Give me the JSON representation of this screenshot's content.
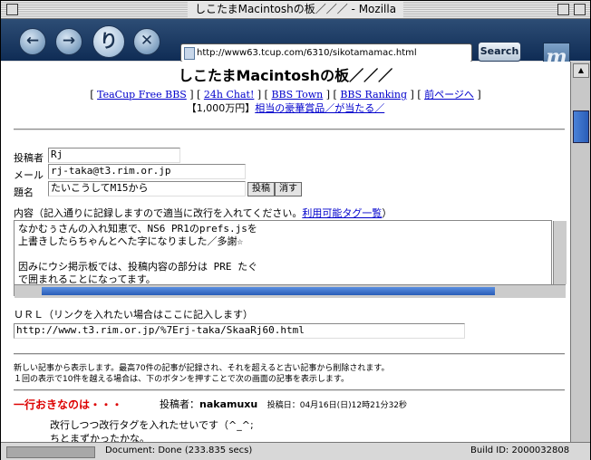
{
  "window": {
    "title": "しこたまMacintoshの板／／／ - Mozilla"
  },
  "toolbar": {
    "url": "http://www63.tcup.com/6310/sikotamamac.html",
    "search_label": "Search",
    "logo": "m",
    "back_icon": "back-arrow",
    "forward_icon": "forward-arrow",
    "reload_glyph": "り",
    "stop_glyph": "✕"
  },
  "page": {
    "heading": "しこたまMacintoshの板／／／",
    "nav_links": [
      "TeaCup Free BBS",
      "24h Chat!",
      "BBS Town",
      "BBS Ranking",
      "前ページへ"
    ],
    "promo_prefix": "【1,000万円】",
    "promo_link": "相当の豪華賞品／が当たる／"
  },
  "form": {
    "poster_label": "投稿者",
    "poster_value": "Rj",
    "email_label": "メール",
    "email_value": "rj-taka@t3.rim.or.jp",
    "subject_label": "題名",
    "subject_value": "たいこうしてM15から",
    "submit_label": "投稿",
    "clear_label": "消す",
    "content_label": "内容（記入通りに記録しますので適当に改行を入れてください。",
    "content_link": "利用可能タグ一覧",
    "content_label_end": "）",
    "content_lines": [
      "なかむぅさんの入れ知恵で、NS6 PR1のprefs.jsを",
      "上書きしたらちゃんとへた字になりました／多謝☆",
      "",
      "因みにウシ掲示板では、投稿内容の部分は PRE たぐ",
      "で囲まれることになってます。"
    ],
    "url_label": "ＵＲＬ（リンクを入れたい場合はここに記入します）",
    "url_value": "http://www.t3.rim.or.jp/%7Erj-taka/SkaaRj60.html"
  },
  "notice": {
    "line1": "新しい記事から表示します。最高70件の記事が記録され、それを超えると古い記事から削除されます。",
    "line2": "１回の表示で10件を越える場合は、下のボタンを押すことで次の画面の記事を表示します。"
  },
  "post": {
    "title": "一行おきなのは・・・",
    "poster_label": "投稿者：",
    "poster_name": "nakamuxu",
    "date_label": "投稿日：",
    "date_value": "04月16日(日)12時21分32秒",
    "body_lines": [
      "改行しつつ改行タグを入れたせいです（^_^;",
      "ちとまずかったかな。"
    ]
  },
  "status": {
    "text": "Document: Done (233.835 secs)",
    "build": "Build ID: 2000032808"
  },
  "colors": {
    "toolbar": "#1f3c66",
    "link": "#0000cc",
    "post_title": "#dd0000",
    "scroll_thumb": "#2a5db8"
  }
}
